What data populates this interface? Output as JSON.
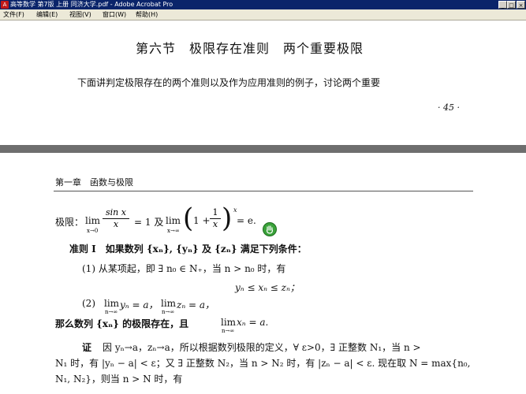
{
  "window": {
    "title": "高等数学 第7版 上册 同济大学.pdf - Adobe Acrobat Pro",
    "minimize": "_",
    "maximize": "□",
    "close": "×"
  },
  "menu": {
    "items": [
      "文件(F)",
      "编辑(E)",
      "视图(V)",
      "窗口(W)",
      "帮助(H)"
    ]
  },
  "page1": {
    "heading": "第六节　极限存在准则　两个重要极限",
    "intro": "下面讲判定极限存在的两个准则以及作为应用准则的例子，讨论两个重要",
    "page_number": "· 45 ·"
  },
  "page2": {
    "running_head": "第一章　函数与极限",
    "limits_line": {
      "prefix": "极限：",
      "lim": "lim",
      "lim1_sub": "x→0",
      "frac1_num": "sin x",
      "frac1_den": "x",
      "eq1": "= 1 及",
      "lim2": "lim",
      "lim2_sub": "x→∞",
      "paren_open": "(",
      "one_plus": "1 +",
      "frac2_num": "1",
      "frac2_den": "x",
      "paren_close": ")",
      "exponent": "x",
      "eq2": "= e."
    },
    "criterion_title": "准则 I　如果数列 {xₙ}, {yₙ} 及 {zₙ} 满足下列条件：",
    "cond1": "(1) 从某项起，即 ∃ n₀ ∈ N₊，当 n > n₀ 时，有",
    "cond1_formula": "yₙ ≤ xₙ ≤ zₙ；",
    "cond2_a": "(2)",
    "cond2_lim1": "lim",
    "cond2_text1": "yₙ = a，",
    "cond2_lim2": "lim",
    "cond2_text2": "zₙ = a，",
    "cond2_sub": "n→∞",
    "conclusion_a": "那么数列 {xₙ} 的极限存在，且",
    "conclusion_lim": "lim",
    "conclusion_b": "xₙ = a.",
    "proof_label": "证",
    "proof1": "因 yₙ→a，zₙ→a，所以根据数列极限的定义，∀ ε>0，∃ 正整数 N₁，当 n >",
    "proof2": "N₁ 时，有 |yₙ − a| < ε；又 ∃ 正整数 N₂，当 n > N₂ 时，有 |zₙ − a| < ε. 现在取 N = max{n₀,",
    "proof3": "N₁, N₂}，则当 n > N 时，有"
  }
}
